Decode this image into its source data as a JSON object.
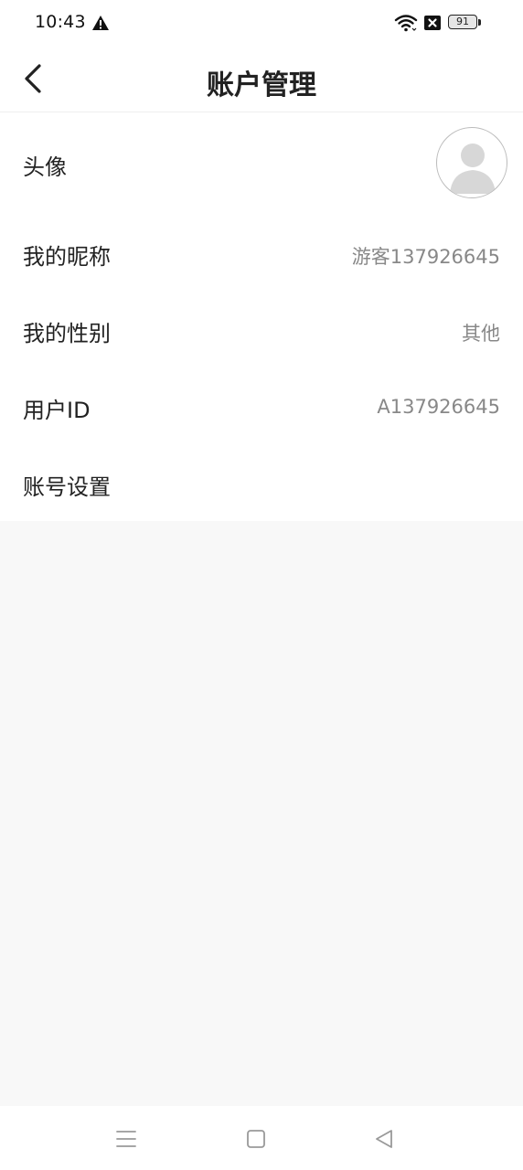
{
  "status_bar": {
    "time": "10:43",
    "battery_level": "91",
    "icons": [
      "warning-icon",
      "wifi-icon",
      "no-sim-icon",
      "battery-icon"
    ]
  },
  "header": {
    "title": "账户管理",
    "back_icon": "chevron-left-icon"
  },
  "rows": [
    {
      "id": "avatar",
      "label": "头像",
      "value": ""
    },
    {
      "id": "nickname",
      "label": "我的昵称",
      "value": "游客137926645"
    },
    {
      "id": "gender",
      "label": "我的性别",
      "value": "其他"
    },
    {
      "id": "user_id",
      "label": "用户ID",
      "value": "A137926645"
    },
    {
      "id": "account_settings",
      "label": "账号设置",
      "value": ""
    }
  ],
  "nav_bar": {
    "icons": [
      "menu-icon",
      "home-square-icon",
      "back-triangle-icon"
    ]
  },
  "colors": {
    "text_primary": "#222222",
    "text_secondary": "#888888",
    "background_grey": "#f8f8f8"
  }
}
